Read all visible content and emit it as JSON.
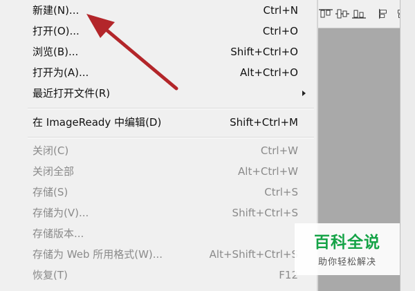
{
  "menu": {
    "items": [
      {
        "label": "新建(N)...",
        "shortcut": "Ctrl+N"
      },
      {
        "label": "打开(O)...",
        "shortcut": "Ctrl+O"
      },
      {
        "label": "浏览(B)...",
        "shortcut": "Shift+Ctrl+O"
      },
      {
        "label": "打开为(A)...",
        "shortcut": "Alt+Ctrl+O"
      },
      {
        "label": "最近打开文件(R)",
        "shortcut": ""
      },
      {
        "label": "在 ImageReady 中编辑(D)",
        "shortcut": "Shift+Ctrl+M"
      },
      {
        "label": "关闭(C)",
        "shortcut": "Ctrl+W"
      },
      {
        "label": "关闭全部",
        "shortcut": "Alt+Ctrl+W"
      },
      {
        "label": "存储(S)",
        "shortcut": "Ctrl+S"
      },
      {
        "label": "存储为(V)...",
        "shortcut": "Shift+Ctrl+S"
      },
      {
        "label": "存储版本...",
        "shortcut": ""
      },
      {
        "label": "存储为 Web 所用格式(W)...",
        "shortcut": "Alt+Shift+Ctrl+S"
      },
      {
        "label": "恢复(T)",
        "shortcut": "F12"
      }
    ]
  },
  "annotation": {
    "arrow_color": "#b3262a",
    "points_to": "新建(N)..."
  },
  "toolbar": {
    "icons": [
      "align-top-icon",
      "align-vcenter-icon",
      "align-bottom-icon",
      "align-left-icon",
      "align-hcenter-icon"
    ]
  },
  "watermark": {
    "title": "百科全说",
    "subtitle": "助你轻松解决",
    "color": "#15a347"
  }
}
